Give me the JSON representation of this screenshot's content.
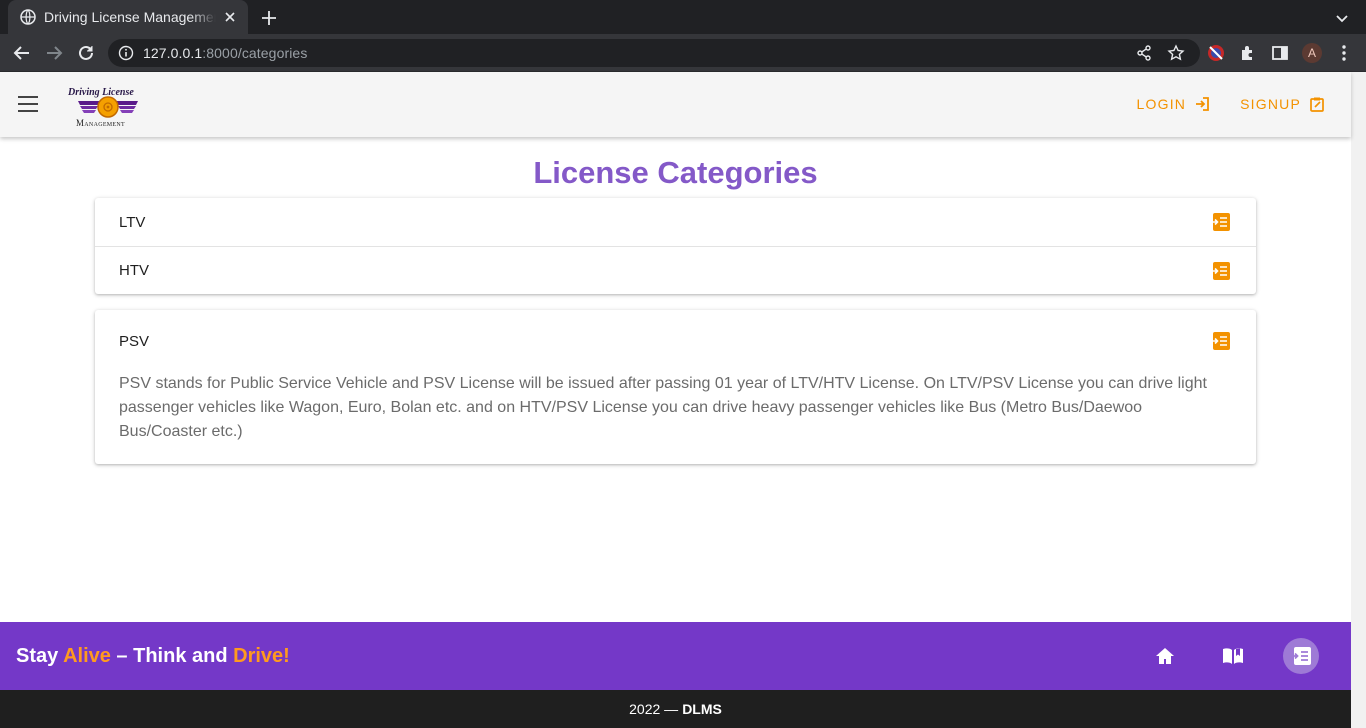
{
  "browser": {
    "tab_title": "Driving License Management",
    "url_host": "127.0.0.1",
    "url_path": ":8000/categories",
    "avatar_letter": "A"
  },
  "header": {
    "logo_top": "Driving License",
    "logo_bottom": "Management",
    "login_label": "LOGIN",
    "signup_label": "SIGNUP"
  },
  "page": {
    "title": "License Categories"
  },
  "categories": {
    "group1": [
      {
        "name": "LTV"
      },
      {
        "name": "HTV"
      }
    ],
    "psv": {
      "name": "PSV",
      "description": "PSV stands for Public Service Vehicle and PSV License will be issued after passing 01 year of LTV/HTV License. On LTV/PSV License you can drive light passenger vehicles like Wagon, Euro, Bolan etc. and on HTV/PSV License you can drive heavy passenger vehicles like Bus (Metro Bus/Daewoo Bus/Coaster etc.)"
    }
  },
  "footer": {
    "slogan_1": "Stay ",
    "slogan_2": "Alive",
    "slogan_3": " – Think and ",
    "slogan_4": "Drive!",
    "copyright": "2022 —",
    "brand": "DLMS",
    "icons": [
      "home-icon",
      "book-icon",
      "license-list-icon"
    ]
  },
  "colors": {
    "accent": "#f39200",
    "brand_purple": "#7438c8",
    "title_purple": "#8459c8",
    "highlight_orange": "#ff9a1f"
  }
}
